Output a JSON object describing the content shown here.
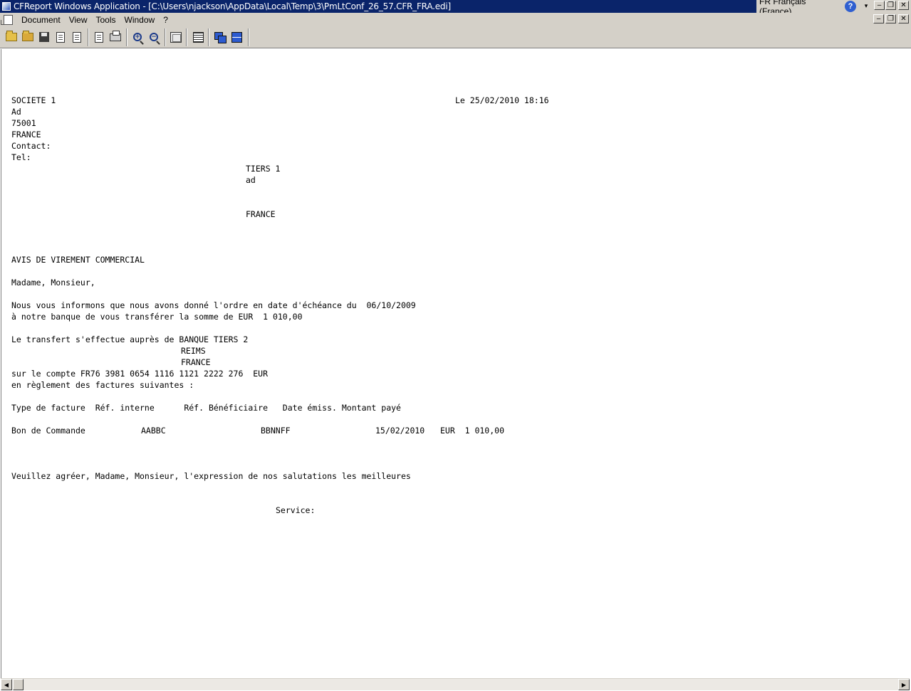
{
  "window": {
    "title": "CFReport Windows Application - [C:\\Users\\njackson\\AppData\\Local\\Temp\\3\\PmLtConf_26_57.CFR_FRA.edi]",
    "language": "FR Français (France)",
    "help_label": "?",
    "minimize": "‒",
    "restore": "❐",
    "close": "✕"
  },
  "menubar": {
    "items": [
      "Document",
      "View",
      "Tools",
      "Window",
      "?"
    ]
  },
  "toolbar": {
    "buttons": [
      {
        "name": "open-folder-icon"
      },
      {
        "name": "open-icon"
      },
      {
        "name": "save-icon"
      },
      {
        "name": "export-icon"
      },
      {
        "name": "page-setup-icon"
      },
      {
        "name": "print-preview-icon"
      },
      {
        "name": "print-icon"
      },
      {
        "name": "zoom-in-icon"
      },
      {
        "name": "zoom-out-icon"
      },
      {
        "name": "frame-icon"
      },
      {
        "name": "grid-icon"
      },
      {
        "name": "cascade-icon"
      },
      {
        "name": "tile-icon"
      }
    ]
  },
  "document": {
    "company": "SOCIETE 1",
    "date_line": "Le 25/02/2010 18:16",
    "address1": "Ad",
    "postcode": "75001",
    "country": "FRANCE",
    "contact": "Contact:",
    "tel": "Tel:",
    "recipient_name": "TIERS 1",
    "recipient_address": "ad",
    "recipient_country": "FRANCE",
    "heading": "AVIS DE VIREMENT COMMERCIAL",
    "salutation": "Madame, Monsieur,",
    "body1": "Nous vous informons que nous avons donné l'ordre en date d'échéance du  06/10/2009",
    "body2": "à notre banque de vous transférer la somme de EUR  1 010,00",
    "transfer_label": "Le transfert s'effectue auprès de BANQUE TIERS 2",
    "bank_city": "REIMS",
    "bank_country": "FRANCE",
    "account": "sur le compte FR76 3981 0654 1116 1121 2222 276  EUR",
    "invoices_intro": "en règlement des factures suivantes :",
    "table_header": "Type de facture  Réf. interne      Réf. Bénéficiaire   Date émiss. Montant payé",
    "row_type": "Bon de Commande",
    "row_ref_int": "AABBC",
    "row_ref_benef": "BBNNFF",
    "row_date": "15/02/2010",
    "row_amount": "EUR  1 010,00",
    "closing": "Veuillez agréer, Madame, Monsieur, l'expression de nos salutations les meilleures",
    "service": "Service:"
  },
  "scrollbar": {
    "left_arrow": "◀",
    "right_arrow": "▶"
  }
}
